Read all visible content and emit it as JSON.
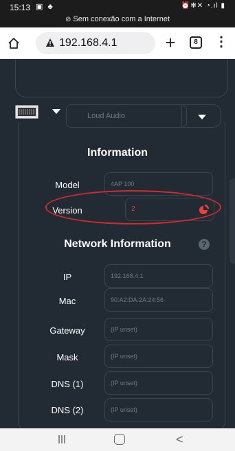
{
  "status_bar": {
    "time": "15:13",
    "left_icons": "▣ ♣",
    "right_icons": "⏰✻✕ ◔.ıl ▮",
    "connection_text": "Sem conexão com a Internet"
  },
  "browser": {
    "url": "192.168.4.1",
    "tab_count": "8",
    "new_tab_label": "+",
    "menu_label": "⋮"
  },
  "device_selector": {
    "name_placeholder": "Loud Audio"
  },
  "information": {
    "title": "Information",
    "model_label": "Model",
    "model_value": "4AP 100",
    "version_label": "Version",
    "version_value": "2"
  },
  "network": {
    "title": "Network Information",
    "help_label": "?",
    "rows": [
      {
        "label": "IP",
        "value": "192.168.4.1"
      },
      {
        "label": "Mac",
        "value": "90:A2:DA:2A:24:56"
      },
      {
        "label": "Gateway",
        "value": "(IP unset)"
      },
      {
        "label": "Mask",
        "value": "(IP unset)"
      },
      {
        "label": "DNS (1)",
        "value": "(IP unset)"
      },
      {
        "label": "DNS (2)",
        "value": "(IP unset)"
      }
    ]
  },
  "nav": {
    "back_label": "<"
  },
  "colors": {
    "background": "#222a33",
    "border": "#3a4450",
    "accent_red": "#e84141",
    "annotation": "#d52b2b"
  }
}
